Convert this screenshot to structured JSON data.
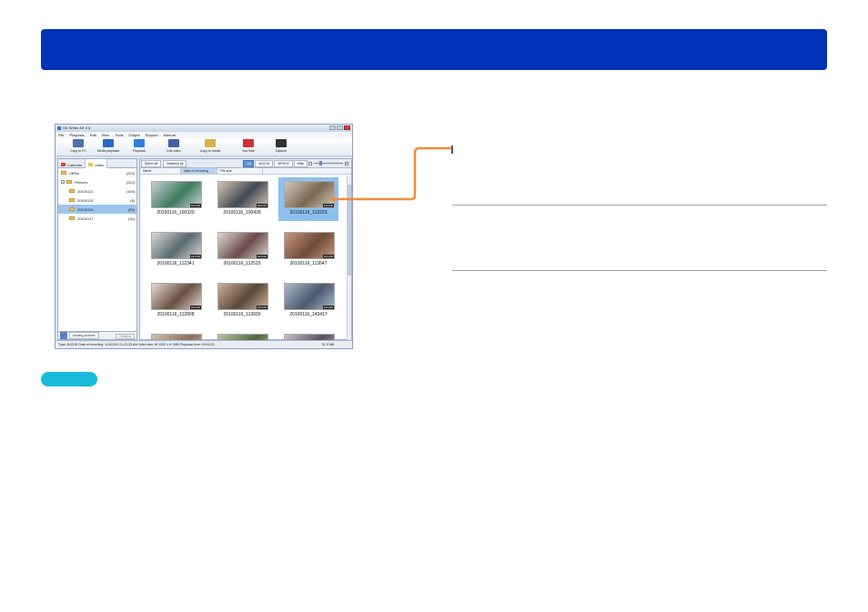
{
  "app": {
    "title": "HD Writer AE 2.6",
    "window_controls": [
      "minimize",
      "maximize",
      "close"
    ]
  },
  "menu": [
    "File",
    "Playback",
    "Edit",
    "View",
    "Tools",
    "Output",
    "Support",
    "Manual"
  ],
  "toolbar": [
    {
      "label": "Copy to PC",
      "icon": "copy-to-pc-icon",
      "color": "#4a6fb0"
    },
    {
      "label": "Media playback",
      "icon": "media-playback-icon",
      "color": "#2b67c8"
    },
    {
      "label": "Playback",
      "icon": "playback-icon",
      "color": "#3080d8"
    },
    {
      "label": "Edit video",
      "icon": "edit-video-icon",
      "color": "#3f5fa8"
    },
    {
      "label": "Copy to media",
      "icon": "copy-to-media-icon",
      "color": "#d8b04a"
    },
    {
      "label": "YouTube",
      "icon": "youtube-icon",
      "color": "#d03030"
    },
    {
      "label": "Capture",
      "icon": "capture-icon",
      "color": "#333333"
    }
  ],
  "left": {
    "tabs": [
      {
        "label": "Calendar"
      },
      {
        "label": "Video"
      }
    ],
    "tree": [
      {
        "label": "UtRes",
        "count": "(222)",
        "level": 0
      },
      {
        "label": "Pictures",
        "count": "(222)",
        "level": 0
      },
      {
        "label": "20100112",
        "count": "(100)",
        "level": 1
      },
      {
        "label": "20100115",
        "count": "(8)",
        "level": 1
      },
      {
        "label": "20100116",
        "count": "(90)",
        "level": 1,
        "selected": true
      },
      {
        "label": "20100117",
        "count": "(16)",
        "level": 1
      }
    ],
    "footer_tab": "Moving pictures",
    "footer_dropdown": "Detailed"
  },
  "right": {
    "select_all": "Select all",
    "deselect_all": "Deselect all",
    "filters": [
      {
        "label": "All",
        "on": true
      },
      {
        "label": "AVCHD"
      },
      {
        "label": "MPEG2"
      },
      {
        "label": "Stills"
      }
    ],
    "sort": [
      {
        "label": "Name"
      },
      {
        "label": "Date of recording",
        "on": true
      },
      {
        "label": "File size"
      }
    ],
    "thumbnails": [
      {
        "caption": "20100116_100320",
        "colors": [
          "#3d7a5a",
          "#c8d0d8"
        ]
      },
      {
        "caption": "20100116_100428",
        "colors": [
          "#404854",
          "#d6c4b0"
        ]
      },
      {
        "caption": "20100116_112223",
        "colors": [
          "#7a6850",
          "#d0c8c0"
        ],
        "selected": true
      },
      {
        "caption": "20100116_112341",
        "colors": [
          "#5a6a70",
          "#d8d8d8"
        ]
      },
      {
        "caption": "20100116_112515",
        "colors": [
          "#6a4a48",
          "#e0d6d0"
        ]
      },
      {
        "caption": "20100116_113647",
        "colors": [
          "#704a38",
          "#c89880"
        ]
      },
      {
        "caption": "20100116_112808",
        "colors": [
          "#6a5040",
          "#e6d8d0"
        ]
      },
      {
        "caption": "20100116_113039",
        "colors": [
          "#5a4638",
          "#cdb49a"
        ]
      },
      {
        "caption": "20100116_143417",
        "colors": [
          "#4a5870",
          "#b0bac8"
        ]
      },
      {
        "caption": "",
        "colors": [
          "#8a7060",
          "#d0c0b0"
        ]
      },
      {
        "caption": "",
        "colors": [
          "#4a6a3a",
          "#b8c8a0"
        ]
      },
      {
        "caption": "",
        "colors": [
          "#5a5060",
          "#c8c0c8"
        ]
      }
    ],
    "badge": "AVCHD"
  },
  "status": {
    "text": "Type: AVCHD  Date of recording: 1/16/2010 11:22:23 AM  Video size: W 1920 x H 1080  Playback time: 00:00:20",
    "size": "51.5 MB"
  },
  "colors": {
    "banner": "#0033b8",
    "callout": "#f08c3c",
    "pill": "#18bcd8"
  }
}
